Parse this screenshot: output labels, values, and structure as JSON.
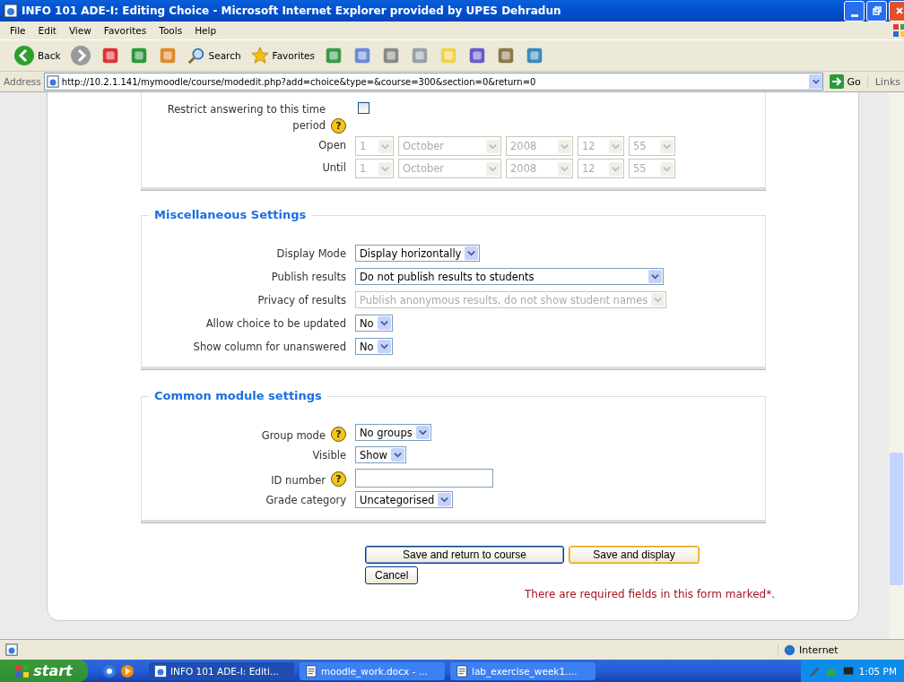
{
  "window": {
    "title": "INFO 101 ADE-I: Editing Choice - Microsoft Internet Explorer provided by UPES Dehradun"
  },
  "menu": [
    "File",
    "Edit",
    "View",
    "Favorites",
    "Tools",
    "Help"
  ],
  "toolbar": [
    {
      "kind": "back",
      "label": "Back"
    },
    {
      "kind": "forward"
    },
    {
      "kind": "stop"
    },
    {
      "kind": "refresh"
    },
    {
      "kind": "home"
    },
    {
      "kind": "search",
      "label": "Search"
    },
    {
      "kind": "favorites",
      "label": "Favorites"
    },
    {
      "kind": "history"
    },
    {
      "kind": "mail"
    },
    {
      "kind": "print"
    },
    {
      "kind": "edit"
    },
    {
      "kind": "note"
    },
    {
      "kind": "messenger"
    },
    {
      "kind": "research"
    },
    {
      "kind": "people"
    }
  ],
  "address": {
    "label": "Address",
    "value": "http://10.2.1.141/mymoodle/course/modedit.php?add=choice&type=&course=300&section=0&return=0",
    "go": "Go",
    "links": "Links"
  },
  "sections": [
    {
      "rows": [
        {
          "kind": "checkbox",
          "label": "Restrict answering to this time period",
          "help": "?",
          "checked": false
        },
        {
          "kind": "date",
          "label": "Open",
          "parts": [
            {
              "value": "1",
              "disabled": true
            },
            {
              "value": "October",
              "disabled": true
            },
            {
              "value": "2008",
              "disabled": true
            },
            {
              "value": "12",
              "disabled": true
            },
            {
              "value": "55",
              "disabled": true
            }
          ]
        },
        {
          "kind": "date",
          "label": "Until",
          "parts": [
            {
              "value": "1",
              "disabled": true
            },
            {
              "value": "October",
              "disabled": true
            },
            {
              "value": "2008",
              "disabled": true
            },
            {
              "value": "12",
              "disabled": true
            },
            {
              "value": "55",
              "disabled": true
            }
          ]
        }
      ]
    },
    {
      "title": "Miscellaneous Settings",
      "rows": [
        {
          "kind": "select",
          "label": "Display Mode",
          "value": "Display horizontally",
          "disabled": false
        },
        {
          "kind": "select",
          "label": "Publish results",
          "value": "Do not publish results to students",
          "disabled": false
        },
        {
          "kind": "select",
          "label": "Privacy of results",
          "value": "Publish anonymous results, do not show student names",
          "disabled": true
        },
        {
          "kind": "select",
          "label": "Allow choice to be updated",
          "value": "No",
          "disabled": false
        },
        {
          "kind": "select",
          "label": "Show column for unanswered",
          "value": "No",
          "disabled": false
        }
      ]
    },
    {
      "title": "Common module settings",
      "rows": [
        {
          "kind": "select",
          "label": "Group mode",
          "help": "?",
          "value": "No groups",
          "disabled": false
        },
        {
          "kind": "select",
          "label": "Visible",
          "value": "Show",
          "disabled": false
        },
        {
          "kind": "text",
          "label": "ID number",
          "help": "?"
        },
        {
          "kind": "select",
          "label": "Grade category",
          "value": "Uncategorised",
          "disabled": false
        }
      ]
    }
  ],
  "buttons": [
    {
      "label": "Save and return to course",
      "selected": true
    },
    {
      "label": "Save and display",
      "selected": false
    },
    {
      "label": "Cancel",
      "selected": false
    }
  ],
  "required_note": "There are required fields in this form marked*.",
  "status_bar": {
    "zone": "Internet"
  },
  "taskbar": {
    "start": "start",
    "windows": [
      {
        "label": "INFO 101 ADE-I: Editi...",
        "kind": "ie",
        "selected": true
      },
      {
        "label": "moodle_work.docx - ...",
        "kind": "doc",
        "selected": false
      },
      {
        "label": "lab_exercise_week1....",
        "kind": "doc",
        "selected": false
      }
    ],
    "time": "1:05 PM"
  }
}
